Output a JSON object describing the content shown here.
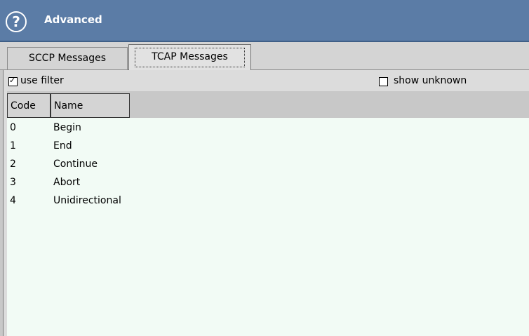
{
  "window": {
    "title": "Advanced",
    "help_icon": "help-circle-icon"
  },
  "tabs": [
    {
      "label": "SCCP Messages",
      "active": false
    },
    {
      "label": "TCAP Messages",
      "active": true
    }
  ],
  "filters": {
    "use_filter": {
      "label": "use filter",
      "checked": true
    },
    "show_unknown": {
      "label": "show unknown",
      "checked": false
    }
  },
  "table": {
    "columns": [
      "Code",
      "Name"
    ],
    "rows": [
      {
        "code": "0",
        "name": "Begin"
      },
      {
        "code": "1",
        "name": "End"
      },
      {
        "code": "2",
        "name": "Continue"
      },
      {
        "code": "3",
        "name": "Abort"
      },
      {
        "code": "4",
        "name": "Unidirectional"
      }
    ]
  },
  "colors": {
    "titlebar": "#5b7ca6",
    "table_background": "#f2fbf5"
  }
}
